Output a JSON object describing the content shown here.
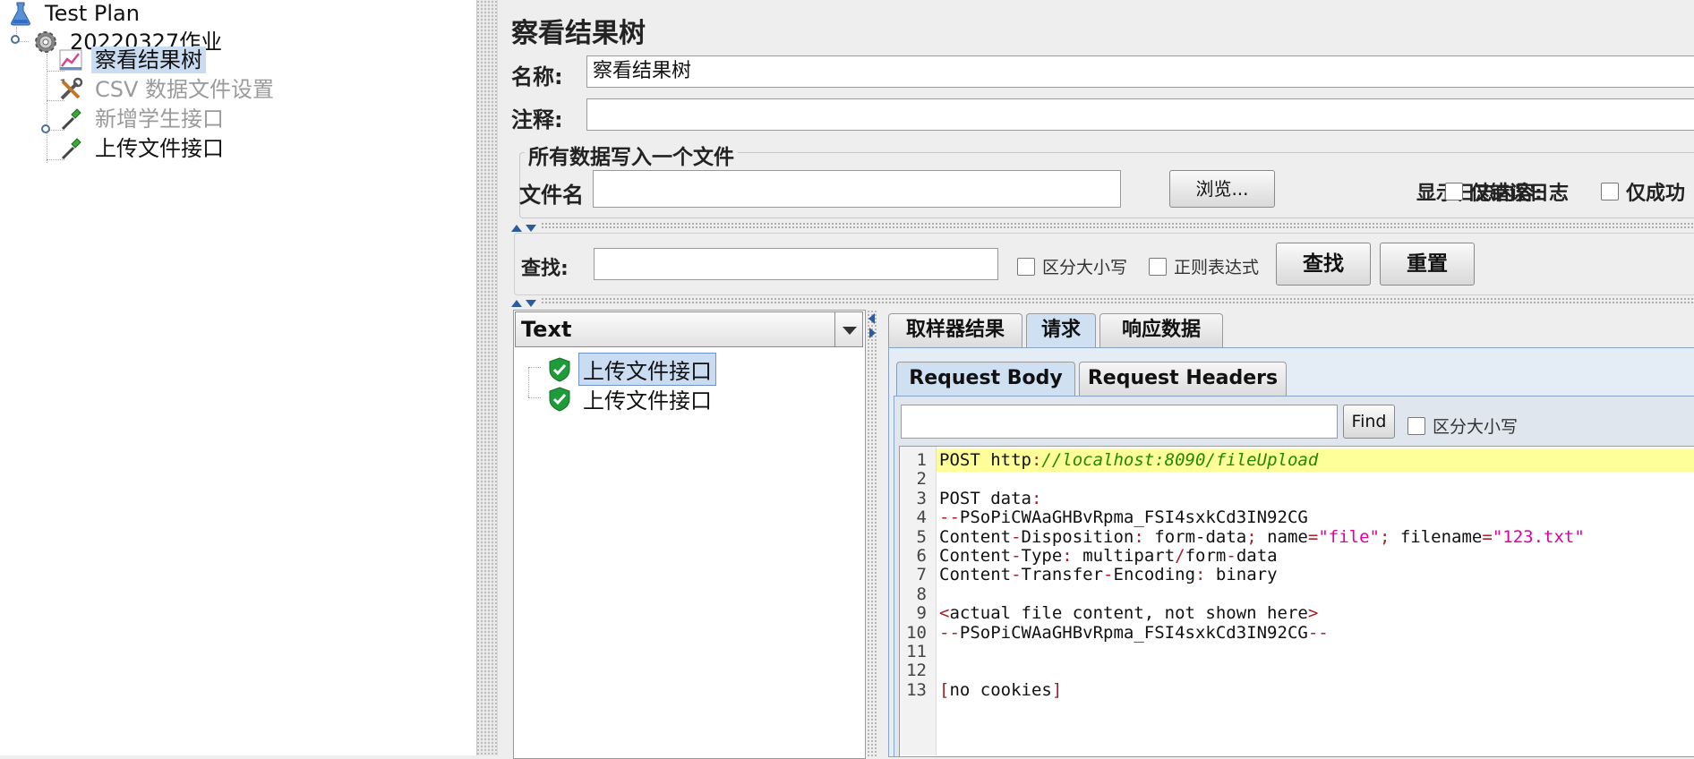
{
  "tree": {
    "items": [
      {
        "label": "Test Plan",
        "icon": "flask-icon"
      },
      {
        "label": "20220327作业",
        "icon": "gear-icon"
      },
      {
        "label": "察看结果树",
        "icon": "chart-icon",
        "selected": true
      },
      {
        "label": "CSV 数据文件设置",
        "icon": "tools-icon",
        "dim": true
      },
      {
        "label": "新增学生接口",
        "icon": "pipette-icon",
        "dim": true
      },
      {
        "label": "上传文件接口",
        "icon": "pipette-icon"
      }
    ]
  },
  "panel": {
    "title": "察看结果树",
    "name_label": "名称:",
    "name_value": "察看结果树",
    "comment_label": "注释:",
    "comment_value": "",
    "file_group_label": "所有数据写入一个文件",
    "filename_label": "文件名",
    "browse_button": "浏览...",
    "log_label": "显示日志内容:",
    "errors_only": "仅错误日志",
    "success_only": "仅成功"
  },
  "search": {
    "label": "查找:",
    "value": "",
    "case_sensitive": "区分大小写",
    "regex": "正则表达式",
    "find_button": "查找",
    "reset_button": "重置"
  },
  "results": {
    "renderer": "Text",
    "samples": [
      "上传文件接口",
      "上传文件接口"
    ]
  },
  "tabs": [
    "取样器结果",
    "请求",
    "响应数据"
  ],
  "subtabs": [
    "Request Body",
    "Request Headers"
  ],
  "body_find": {
    "button": "Find",
    "case_label": "区分大小写"
  },
  "code_lines": [
    "POST http://localhost:8090/fileUpload",
    "",
    "POST data:",
    "--PSoPiCWAaGHBvRpma_FSI4sxkCd3IN92CG",
    "Content-Disposition: form-data; name=\"file\"; filename=\"123.txt\"",
    "Content-Type: multipart/form-data",
    "Content-Transfer-Encoding: binary",
    "",
    "<actual file content, not shown here>",
    "--PSoPiCWAaGHBvRpma_FSI4sxkCd3IN92CG--",
    "",
    "",
    "[no cookies]"
  ],
  "colors": {
    "selection": "#c9dcf1",
    "highlight_line": "#ffff99",
    "success_shield": "#1f9c3a"
  }
}
